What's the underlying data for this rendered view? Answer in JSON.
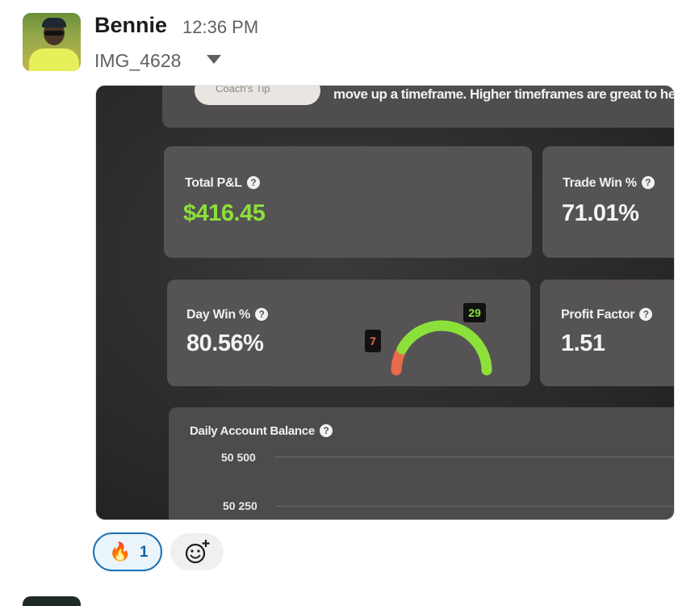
{
  "message": {
    "author": "Bennie",
    "time": "12:36 PM",
    "attachment_name": "IMG_4628"
  },
  "photo": {
    "coach_button": "Coach's Tip",
    "tip_text": "move up a timeframe. Higher timeframes are great to help",
    "cards": [
      {
        "label": "Total P&L",
        "value": "$416.45",
        "color": "#8be13a"
      },
      {
        "label": "Trade Win %",
        "value": "71.01%",
        "color": "#f4f4f4"
      },
      {
        "label": "Day Win %",
        "value": "80.56%",
        "color": "#f4f4f4"
      },
      {
        "label": "Profit Factor",
        "value": "1.51",
        "color": "#f4f4f4"
      }
    ],
    "gauge": {
      "losing_days": "7",
      "winning_days": "29",
      "win_color": "#8be13a",
      "loss_color": "#e86a4a"
    },
    "balance_panel": {
      "title": "Daily Account Balance",
      "ticks": [
        "50 500",
        "50 250"
      ]
    },
    "help_glyph": "?"
  },
  "reactions": [
    {
      "icon": "fire-icon",
      "emoji": "🔥",
      "count": "1"
    }
  ],
  "add_reaction_icon": "add-emoji-icon"
}
